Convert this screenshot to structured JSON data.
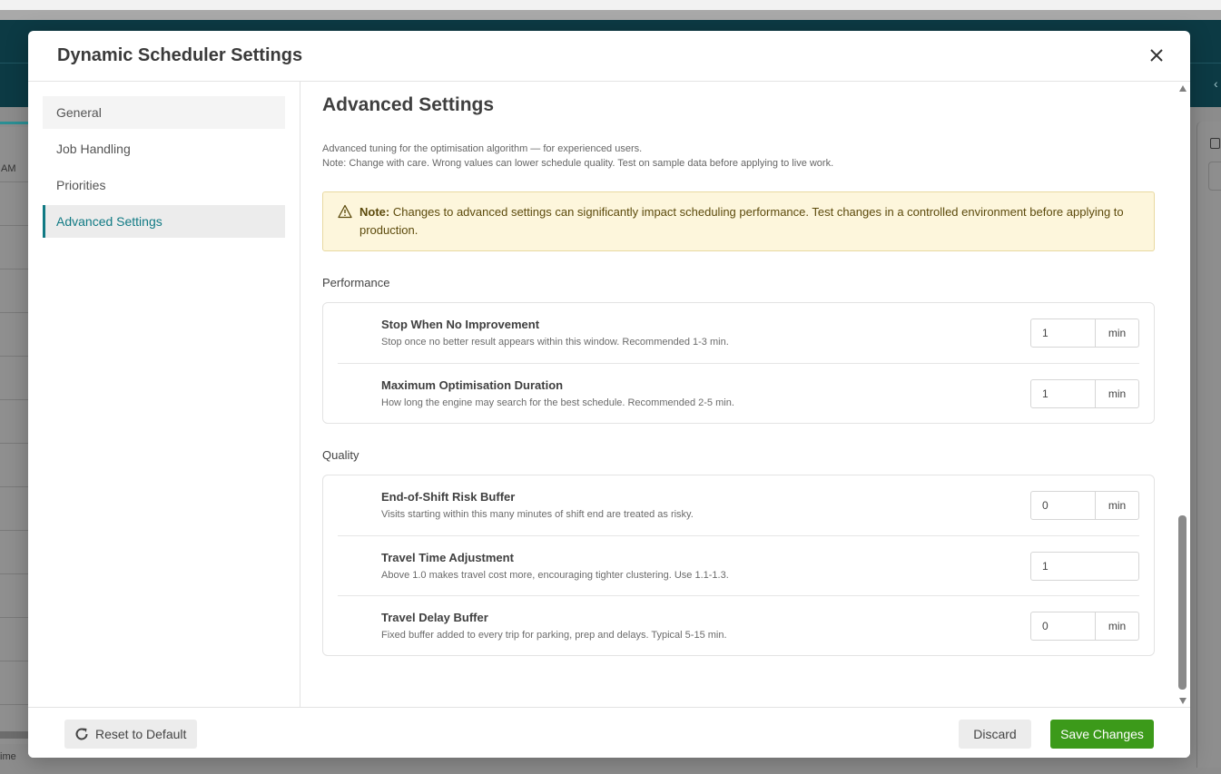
{
  "background": {
    "am_label": "AM",
    "time_label": "ime"
  },
  "modal": {
    "title": "Dynamic Scheduler Settings",
    "close_icon": "close-icon"
  },
  "sidebar": {
    "items": [
      {
        "label": "General"
      },
      {
        "label": "Job Handling"
      },
      {
        "label": "Priorities"
      },
      {
        "label": "Advanced Settings",
        "active": true
      }
    ]
  },
  "content": {
    "title": "Advanced Settings",
    "desc_line1": "Advanced tuning for the optimisation algorithm — for experienced users.",
    "desc_line2": "Note: Change with care. Wrong values can lower schedule quality. Test on sample data before applying to live work.",
    "note": {
      "icon": "warning-icon",
      "label": "Note:",
      "text": "Changes to advanced settings can significantly impact scheduling performance. Test changes in a controlled environment before applying to production."
    },
    "performance": {
      "label": "Performance",
      "rows": [
        {
          "label": "Stop When No Improvement",
          "help": "Stop once no better result appears within this window. Recommended 1-3 min.",
          "value": "1",
          "unit": "min"
        },
        {
          "label": "Maximum Optimisation Duration",
          "help": "How long the engine may search for the best schedule. Recommended 2-5 min.",
          "value": "1",
          "unit": "min"
        }
      ]
    },
    "quality": {
      "label": "Quality",
      "rows": [
        {
          "label": "End-of-Shift Risk Buffer",
          "help": "Visits starting within this many minutes of shift end are treated as risky.",
          "value": "0",
          "unit": "min"
        },
        {
          "label": "Travel Time Adjustment",
          "help": "Above 1.0 makes travel cost more, encouraging tighter clustering. Use 1.1-1.3.",
          "value": "1"
        },
        {
          "label": "Travel Delay Buffer",
          "help": "Fixed buffer added to every trip for parking, prep and delays. Typical 5-15 min.",
          "value": "0",
          "unit": "min"
        }
      ]
    }
  },
  "footer": {
    "reset_label": "Reset to Default",
    "reset_icon": "refresh-icon",
    "discard_label": "Discard",
    "save_label": "Save Changes"
  },
  "colors": {
    "accent": "#117a84",
    "save": "#3c9a1a",
    "note_bg": "#fdf6dc",
    "header_bg": "#0c3a44"
  }
}
